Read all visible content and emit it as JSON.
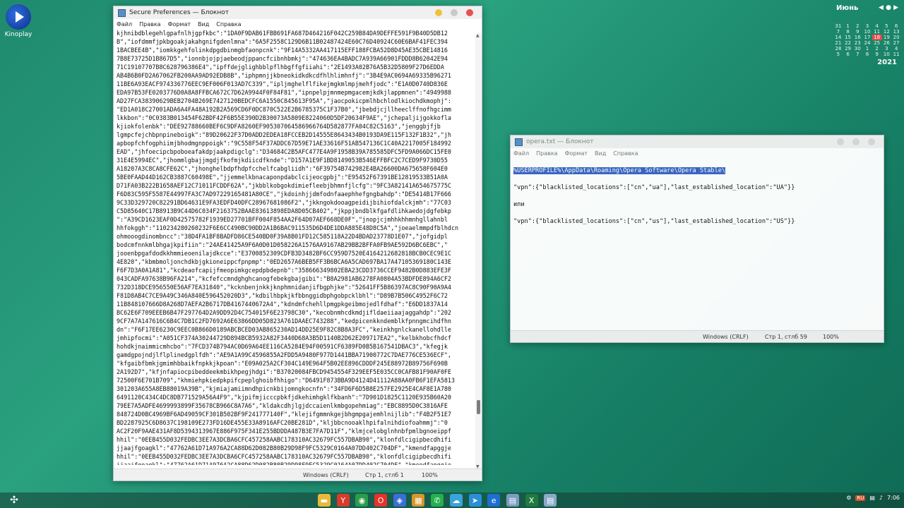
{
  "desktop": {
    "icon_label": "Kinoplay",
    "calendar": {
      "month": "Июнь",
      "year": "2021",
      "weeks": [
        [
          "31",
          "1",
          "2",
          "3",
          "4",
          "5",
          "6"
        ],
        [
          "7",
          "8",
          "9",
          "10",
          "11",
          "12",
          "13"
        ],
        [
          "14",
          "15",
          "16",
          "17",
          "18",
          "19",
          "20"
        ],
        [
          "21",
          "22",
          "23",
          "24",
          "25",
          "26",
          "27"
        ],
        [
          "28",
          "29",
          "30",
          "1",
          "2",
          "3",
          "4"
        ],
        [
          "5",
          "6",
          "7",
          "8",
          "9",
          "10",
          "11"
        ]
      ],
      "today": "18"
    }
  },
  "main_window": {
    "title": "Secure Preferences — Блокнот",
    "menu": [
      "Файл",
      "Правка",
      "Формат",
      "Вид",
      "Справка"
    ],
    "lines": [
      "kjhnibdblegehlgpafnlhjgpfkbc\":\"1DA0F9DAB61FBB691FA687D464216F042C259B84DA9DEFFE591F9B40D5DB12",
      "B\",\"iofdmmfjpkbgoakjakahgnifgdenlmna\":\"6A5F2558C129D6B11B02487424E60C76D40924C60E6BAF41FEC394",
      "1BACBEE4B\",\"iomkkgehfolinkdpgdbinmgbfaonpcnk\":\"9F14A5332AA417115EFF188FCBA52D8D45AE35CBE14816",
      "7B8E73725D1B867D5\",\"ionnbjojpjaebeodjppancfcibnhbmkj\":\"474636EA4BADC7A939A66901FDDD8B62042E94",
      "71C19107707B8C628796386E4\",\"ipffdejglighbblpflhbgffgfiiahi\":\"2E1493A02B76A5B32D5809F27D6EDDA",
      "AB4B6B0FD2A67062FB200AA9AD92EDB8B\",\"iphpmnjjkbneokidkdkcdfhlhlimhnfj\":\"3B4E9AC0694A69335B96271",
      "11BE6A93EACF974336776EEC9EF006F013AD7C339\",\"ipljmghelflfikejmgkmlmpjmehfjodc\":\"E1A0D0740D836E",
      "EDA97B53FE0203776D0A8A8FFBCA672C7D62A9944F0F84F81\",\"ipnpelpjmnmepmgacemjkdkjlappmnen\":\"4949988",
      "AD27FCA38390629BEB2704B269E7427120BEDCFC6A1550C845613F95A\",\"jaocpokicpmlhbchlodlkiochdkmophj\":",
      "\"ED1A018C27001ADA6A4FA48A192B2A569CD6F0DC870C522E2B6785375C1F37B0\",\"jbebdjcjllheeclffnofhgcimm",
      "lkkbon\":\"0C0383B013454F62BDF42F6B55E390D2B30073A5809E8224060D5DF20634F9AE\",\"jchepaljijgokkofla",
      "kjiokfolenbk\":\"DEE92788660BEF6C9DFA8260EF905307064586966764D582877FA04C82C5163\",\"jenggbjfjb",
      "lgmpcfejchbpnpineboigk\":\"89D20622F37D0ADD2EDEA18FCCEB2D14555E8643434B0193DA9E115F132F1B32\",\"jh",
      "apbopfchfogphiimjbhodmgnppoigk\":\"9C558F54F37ADDC67D59E71AE33616F51AB547136C1C40A2217005F184992",
      "EAD\",\"jhfoecipcbpoboeafakdpjaakpdigclg\":\"D34684C2B5AFC477E4A9F1958B39A785585DFC5FD9A066DC15FE0",
      "31E4E5994EC\",\"jhommlgbajjmgdjfkofmjkdiicdfknde\":\"D157A1E9F1BD8149053B546EFFBFC2C7CED9F9730D55",
      "A18207A3C8CA8CFE62C\",\"jhonghelbdpfhdpfcchelfcabgliidh\":\"6F39754B742982E4BA26600DA675658F604E0",
      "5BE0FAAD44D162CB3887C60498E\",\"jjemmelkbnacaponpdabclcijeocgpbj\":\"E95452F67391BE12819533B51A0A",
      "D71FA03B222B1658AEF12C71011FCDDF62A\",\"jkbblkobgokdimiefleebjbhmnfjlcfg\":\"9FC3A82141A654675775C",
      "F6D83C595F5587E44997FA3C7AD97229165481A80CE\",\"jkdoinhjjdmfodnfaaephhefgngbahdp\":\"DE5414B17F666",
      "9C33D329720C82291BD64631E9FA3EDFD40DFC28967681086F2\",\"jkkngokdooagpeidijbihiofdalckjmh\":\"77C03",
      "C5D85640C17B8913B9C44D6C034F2163752BAAE83613898EDA8D05CB402\",\"jkppjbndblkfgafdlihkaedojdgfebkp",
      "\":\"A39CD1623EAF0D42575782F1939ED27701BFF004F854AA2F64D07AEF668DE0F\",\"jnopjcjmhhkhhmnhgllahnbl",
      "hhfokggh\":\"110234280260232F6E6CC490BC90DD2A1B6BAC911535D6D4DE1DDA885E48D8C5A\",\"joeaelmmpdfblhdcn",
      "ohmooogdinombncc\":\"38D4FA1BF8BADFD86CE540BD0F39A8B01FD12C585118A22D4BDAD23778D1E07\",\"jofgidpl",
      "bodcmfnnkmlbhgajkpifiin\":\"24AE41425A9F6A0D01D058226A1576AA9167AB29BB2BFFA0FB9AE592D6BC6EBC\",\"",
      "jooenbpgafdodkkhmmieoenilajdkcce\":\"E3700852309CDFB3D3482BF6CC959D7520E4164212682818BCB0CEC9E1C",
      "4E820\",\"kbmbmoljonchdkbjgkioneippcfpnpmp\":\"0ED2657A6BEB5FF3B6BCA6A5CAD697BA17A47105369180C143E",
      "F6F7D3A0A1A81\",\"kcdeaofcapijfmeopimkgcepdpbdepnb\":\"358666349802EBA23CDD3736CCEF9482B0D883EFE3F",
      "043CADFA97638B96FA214\",\"kcfefccmndghghcanogfebekgbajgibi\":\"B8A2981AB6278FA0804A53BDFDE894A6CF2",
      "732D318DCE956550E56AF7EA31840\",\"kcknbenjnkkjknphmnidanjifbgphjke\":\"52641FF5B86397AC8C90F90A9A4",
      "F81D8AB4C7CE9A49C346A840E596452020D3\",\"kdbilhbpkjkfbbnggidbphgobpcklbhl\":\"D89B7B506C4952F6C72",
      "11B848107666D8A268D7AEFA2B6717DB4167440672A4\",\"kdndmfchehllpmgpkgeibmojedlfdhaf\":\"E6DD1837A14",
      "BC62E6F709EEEB6B47F297764D2A9DD92D4C754015F6E23798C30\",\"kecobnmhcdkmdjifldaeiiaajaggahdp\":\"202",
      "9CF7A7A147616C6B4C7DB1C2FD7692A6E63866DD05D823A761DAAEC743288\",\"kedpicenkkndemblkfpnngmcihdfhn",
      "dn\":\"F6F17EE6230C9EEC0B866D0189ABCBCED03AB865230AD14DD25E9F82C8B8A3FC\",\"keinkhgnlckanellohdlle",
      "jmhipfocmi\":\"A051CF374A30244729D894BCB5932A82F3440D68A3B5D1140B2D62E209717EA2\",\"kelbkhobcfhdcf",
      "hohdkjnaimmicmhcbo\":\"7FCD374B794AC0D69A64EE116CA5284E94F00591CF6389FD0B5B167541DBAC3\",\"kfegjk",
      "gamdgpojndjlflplinedgplfdh\":\"AE9A1A99C4596855A2FDD5A9480F977D1441BBA71900772C7DAE776CE536ECF\",",
      "\"kfgaibfbmkjgmimhbbaikfnpkkjkpoan\":\"E09A025A2CF304C149E964F5B02EE896CDDDF245E88972B89756F690B",
      "2A192D7\",\"kfjnfapiocpibeddeekmbikhpegjhdgi\":\"B37020084FBCD9454554F329EEF5E035CC0CAFB81F90AF0FE",
      "72500F6E701B709\",\"khmiehpkiedpkpifcpeplghoibfhhigo\":\"D6491F873BBA9D4124D41112A88AA0FB6F1EFA5813",
      "301203A655A8EB88019A39B\",\"kjmiajamiimndhpicnkbijomngkocnfn\":\"34FD6F6D5B8E257FE2925E4CAF8E1A780",
      "6491120C434C4DC8DB771529A56A4F9\",\"kjpifmjicccpbkfjdkehimhgklfkbanh\":\"7D901D1825C1120E935B60A20",
      "79EE7A5ADFE4699993899F35678CB966C8A7A6\",\"kldakcdhjlgjdccaienlkmbgopehmiag\":\"EBC8895D0C3816AFE",
      "848724D0BC4969BF6AD49059CF301B502BF9F241777140F\",\"klejifgmmnkgejbhgmpgajemhlnijlib\":\"F4B2F51E7",
      "BD2287925C6D8637C198109E273FD16DE455E33A8916AFC20BE281D\",\"kljbbcnooaklhpifalnihdiofoahmmj\":\"0",
      "AC2F20F9AAE431AF8D5394313967E886F975F341E255BDDDA487B3E7FA7D11F\",\"klmjcelobglnhnbfpmlbgnoeippf",
      "hhil\":\"0EEB455D032FEDBC3EE7A3DCBA6CFC457258AABC178310AC32679FC557DBAB90\",\"klonfdlcigipbecdhifi",
      "jjaajfgoagkl\":\"47762A61D71A976A2CA88D62D082B80B29D98F9FC5329C0164A07DD402C704DF\",\"kmendfapggje",
      "hhil\":\"0EEB455D032FEDBC3EE7A3DCBA6CFC457258AABC178310AC32679FC557DBAB90\",\"klonfdlcigipbecdhifi",
      "jjaajfgoagkl\":\"47762A61D71A976A2CA88D62D082B80B29D98F9FC5329C0164A07DD402C704DF\",\"kmendfapggje"
    ],
    "status_encoding": "Windows (CRLF)",
    "status_position": "Стр 1, стлб 1",
    "status_zoom": "100%"
  },
  "opera_window": {
    "title": "opera.txt — Блокнот",
    "menu": [
      "Файл",
      "Правка",
      "Формат",
      "Вид",
      "Справка"
    ],
    "line_selected": "%USERPROFILE%\\AppData\\Roaming\\Opera Software\\Opera Stable\\",
    "line_ua": "\"vpn\":{\"blacklisted_locations\":[\"cn\",\"ua\"],\"last_established_location\":\"UA\"}}",
    "line_or": "или",
    "line_us": "\"vpn\":{\"blacklisted_locations\":[\"cn\",\"us\"],\"last_established_location\":\"US\"}}",
    "status_encoding": "Windows (CRLF)",
    "status_position": "Стр 1, стлб 59",
    "status_zoom": "100%"
  },
  "taskbar": {
    "lang": "RU",
    "clock": "7:06",
    "icons": [
      "folder-icon",
      "yandex-icon",
      "chrome-icon",
      "opera-icon",
      "app-icon",
      "archive-icon",
      "whatsapp-icon",
      "cloud-icon",
      "telegram-icon",
      "edge-icon",
      "notepad-icon",
      "excel-icon",
      "notepad-active-icon"
    ]
  },
  "colors": {
    "desktop": "#1f8a6e",
    "selection": "#3a64c4",
    "today": "#e84a4a"
  }
}
